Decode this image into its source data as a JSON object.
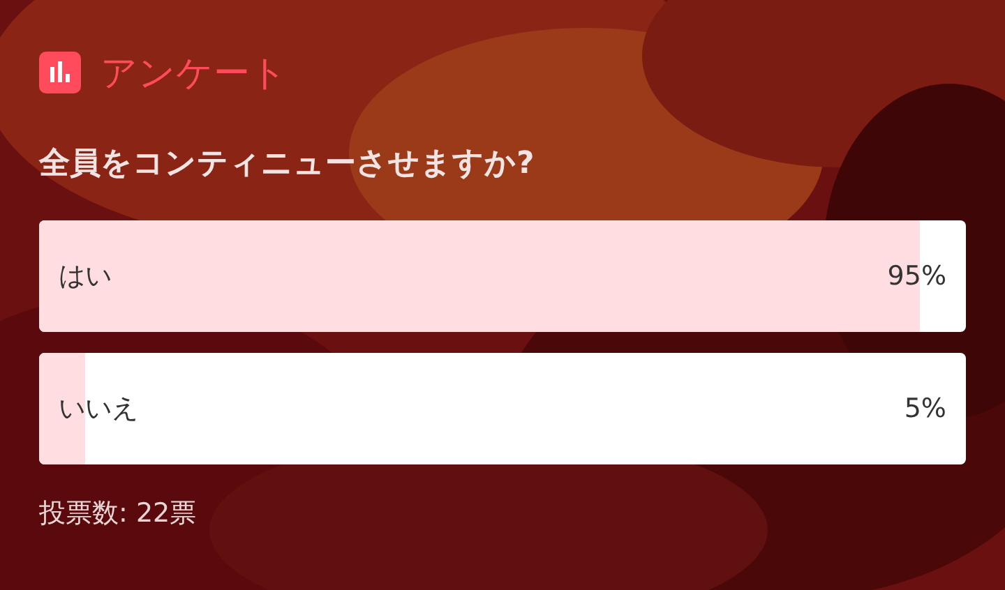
{
  "poll": {
    "title": "アンケート",
    "question": "全員をコンティニューさせますか?",
    "options": [
      {
        "label": "はい",
        "reading": "95%",
        "level": 0.95
      },
      {
        "label": "いいえ",
        "reading": "5%",
        "level": 0.05
      }
    ],
    "footer": "投票数: 22票"
  }
}
